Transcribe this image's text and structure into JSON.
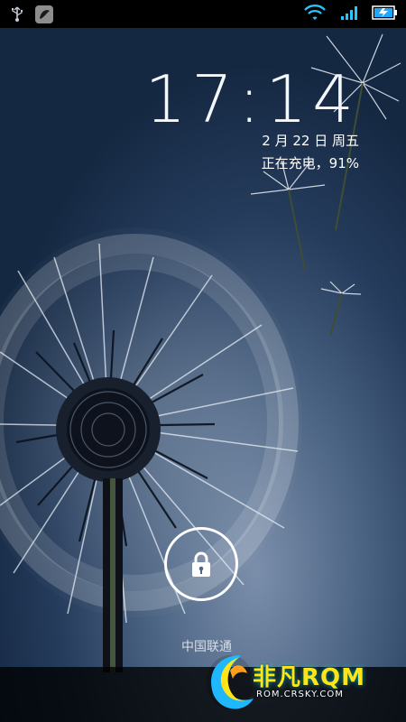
{
  "status_bar": {
    "left_icons": [
      "usb-icon",
      "notification-leaf-icon"
    ],
    "right_icons": [
      "wifi-icon",
      "signal-icon",
      "battery-charging-icon"
    ]
  },
  "lock_screen": {
    "time": "17:14",
    "date": "2 月 22 日 周五",
    "charging_status": "正在充电，91%",
    "carrier": "中国联通",
    "unlock_icon": "lock-icon"
  },
  "watermark": {
    "brand": "非凡RQM",
    "url": "ROM.CRSKY.COM"
  },
  "colors": {
    "statusbar": "#000000",
    "wifi": "#26c7ff",
    "battery": "#1ea7ff",
    "watermark": "#ffe419"
  }
}
